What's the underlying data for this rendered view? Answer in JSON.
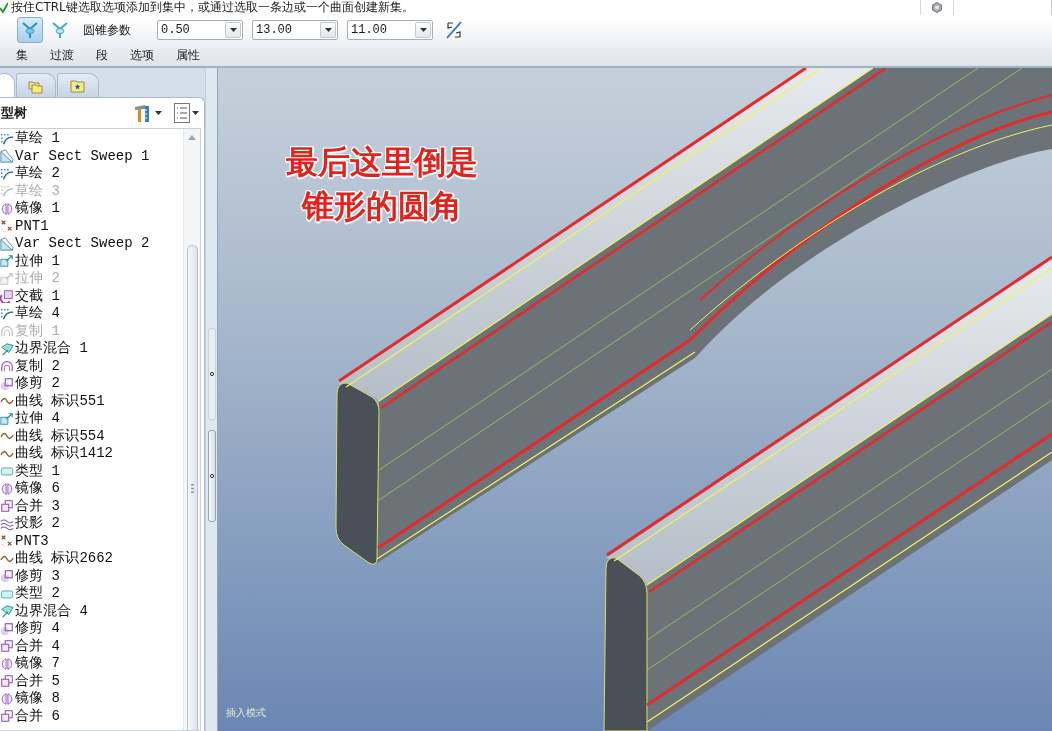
{
  "message": {
    "text": "按住CTRL键选取选项添加到集中，或通过选取一条边或一个曲面创建新集。"
  },
  "toolbar": {
    "modes": [
      {
        "selected": true
      },
      {
        "selected": false
      }
    ],
    "label": "圆锥参数",
    "fields": [
      {
        "value": "0.50"
      },
      {
        "value": "13.00"
      },
      {
        "value": "11.00"
      }
    ]
  },
  "dashboard_tabs": [
    {
      "label": "集"
    },
    {
      "label": "过渡"
    },
    {
      "label": "段"
    },
    {
      "label": "选项"
    },
    {
      "label": "属性"
    }
  ],
  "panel_tabs": [
    {
      "kind": "blank",
      "selected": true
    },
    {
      "kind": "folders",
      "selected": false
    },
    {
      "kind": "star-folder",
      "selected": false
    }
  ],
  "model_tree": {
    "title": "型树",
    "items": [
      {
        "label": "草绘 1",
        "kind": "sketch",
        "disabled": false
      },
      {
        "label": "Var Sect Sweep 1",
        "kind": "sweep",
        "disabled": false
      },
      {
        "label": "草绘 2",
        "kind": "sketch",
        "disabled": false
      },
      {
        "label": "草绘 3",
        "kind": "sketch",
        "disabled": true
      },
      {
        "label": "镜像 1",
        "kind": "mirror",
        "disabled": false
      },
      {
        "label": "PNT1",
        "kind": "point",
        "disabled": false
      },
      {
        "label": "Var Sect Sweep 2",
        "kind": "sweep",
        "disabled": false
      },
      {
        "label": "拉伸 1",
        "kind": "extrude",
        "disabled": false
      },
      {
        "label": "拉伸 2",
        "kind": "extrude",
        "disabled": true
      },
      {
        "label": "交截 1",
        "kind": "intersect",
        "disabled": false
      },
      {
        "label": "草绘 4",
        "kind": "sketch",
        "disabled": false
      },
      {
        "label": "复制 1",
        "kind": "copy",
        "disabled": true
      },
      {
        "label": "边界混合 1",
        "kind": "blend",
        "disabled": false
      },
      {
        "label": "复制 2",
        "kind": "copy",
        "disabled": false
      },
      {
        "label": "修剪 2",
        "kind": "trim",
        "disabled": false
      },
      {
        "label": "曲线 标识551",
        "kind": "curve",
        "disabled": false
      },
      {
        "label": "拉伸 4",
        "kind": "extrude",
        "disabled": false
      },
      {
        "label": "曲线 标识554",
        "kind": "curve",
        "disabled": false
      },
      {
        "label": "曲线 标识1412",
        "kind": "curve",
        "disabled": false
      },
      {
        "label": "类型 1",
        "kind": "type",
        "disabled": false
      },
      {
        "label": "镜像 6",
        "kind": "mirror",
        "disabled": false
      },
      {
        "label": "合并 3",
        "kind": "merge",
        "disabled": false
      },
      {
        "label": "投影 2",
        "kind": "project",
        "disabled": false
      },
      {
        "label": "PNT3",
        "kind": "point",
        "disabled": false
      },
      {
        "label": "曲线 标识2662",
        "kind": "curve",
        "disabled": false
      },
      {
        "label": "修剪 3",
        "kind": "trim",
        "disabled": false
      },
      {
        "label": "类型 2",
        "kind": "type",
        "disabled": false
      },
      {
        "label": "边界混合 4",
        "kind": "blend",
        "disabled": false
      },
      {
        "label": "修剪 4",
        "kind": "trim",
        "disabled": false
      },
      {
        "label": "合并 4",
        "kind": "merge",
        "disabled": false
      },
      {
        "label": "镜像 7",
        "kind": "mirror",
        "disabled": false
      },
      {
        "label": "合并 5",
        "kind": "merge",
        "disabled": false
      },
      {
        "label": "镜像 8",
        "kind": "mirror",
        "disabled": false
      },
      {
        "label": "合并 6",
        "kind": "merge",
        "disabled": false
      }
    ]
  },
  "viewport": {
    "annotation": [
      "最后这里倒是",
      "锥形的圆角"
    ],
    "mode_text": "插入模式"
  }
}
